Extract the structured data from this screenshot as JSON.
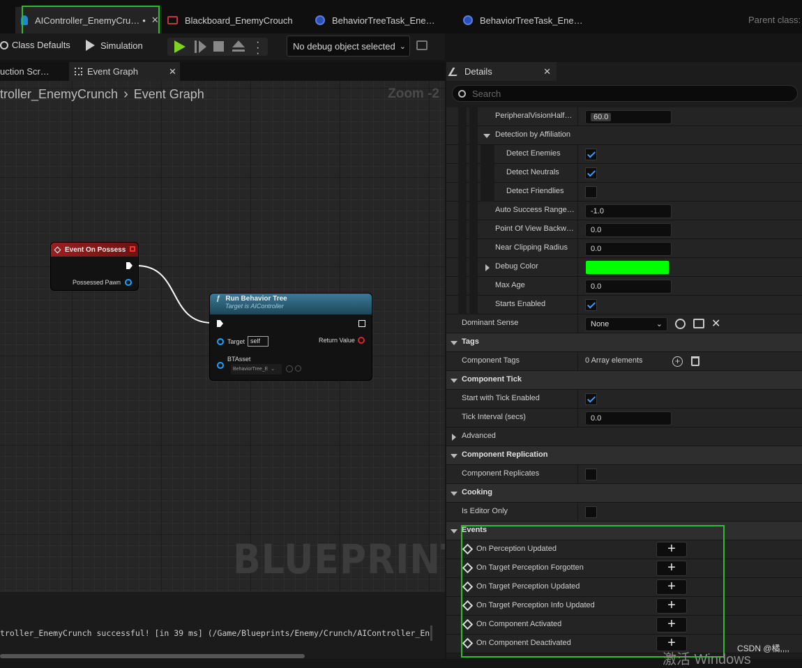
{
  "tabs": {
    "doc1": "AIController_EnemyCru…",
    "doc1_modified": "•",
    "doc2": "Blackboard_EnemyCrouch",
    "doc3": "BehaviorTreeTask_Ene…",
    "doc4": "BehaviorTreeTask_Ene…",
    "parent_class": "Parent class:"
  },
  "toolbar": {
    "class_defaults": "Class Defaults",
    "simulation": "Simulation",
    "debug_object": "No debug object selected"
  },
  "graph_tabs": {
    "construction": "uction Scr…",
    "event_graph": "Event Graph"
  },
  "graph": {
    "breadcrumb_root": "troller_EnemyCrunch",
    "breadcrumb_leaf": "Event Graph",
    "zoom": "Zoom -2",
    "watermark": "BLUEPRINT"
  },
  "nodes": {
    "possess": {
      "title": "Event On Possess",
      "pin_pawn": "Possessed Pawn",
      "color": "#8c1c1c"
    },
    "run_bt": {
      "title": "Run Behavior Tree",
      "subtitle": "Target is AIController",
      "pin_target": "Target",
      "target_value": "self",
      "pin_return": "Return Value",
      "pin_btasset": "BTAsset",
      "btasset_value": "BehaviorTree_E",
      "color": "#2f6a86"
    }
  },
  "log": {
    "line": "troller_EnemyCrunch successful! [in 39 ms] (/Game/Blueprints/Enemy/Crunch/AIController_En"
  },
  "details": {
    "tab": "Details",
    "search_placeholder": "Search",
    "rows": {
      "peripheral": {
        "label": "PeripheralVisionHalf…",
        "value": "60.0"
      },
      "detection_affiliation": "Detection by Affiliation",
      "detect_enemies": "Detect Enemies",
      "detect_neutrals": "Detect Neutrals",
      "detect_friendlies": "Detect Friendlies",
      "auto_success": {
        "label": "Auto Success Range…",
        "value": "-1.0"
      },
      "pov_backward": {
        "label": "Point Of View Backw…",
        "value": "0.0"
      },
      "near_clipping": {
        "label": "Near Clipping Radius",
        "value": "0.0"
      },
      "debug_color": {
        "label": "Debug Color",
        "color": "#00ff00"
      },
      "max_age": {
        "label": "Max Age",
        "value": "0.0"
      },
      "starts_enabled": "Starts Enabled",
      "dominant_sense": {
        "label": "Dominant Sense",
        "value": "None"
      },
      "tags_cat": "Tags",
      "component_tags": {
        "label": "Component Tags",
        "value": "0 Array elements"
      },
      "tick_cat": "Component Tick",
      "start_tick": "Start with Tick Enabled",
      "tick_interval": {
        "label": "Tick Interval (secs)",
        "value": "0.0"
      },
      "advanced": "Advanced",
      "replication_cat": "Component Replication",
      "replicates": "Component Replicates",
      "cooking_cat": "Cooking",
      "editor_only": "Is Editor Only",
      "events_cat": "Events",
      "ev1": "On Perception Updated",
      "ev2": "On Target Perception Forgotten",
      "ev3": "On Target Perception Updated",
      "ev4": "On Target Perception Info Updated",
      "ev5": "On Component Activated",
      "ev6": "On Component Deactivated"
    }
  },
  "overlay": {
    "csdn": "CSDN @橘,,,,",
    "windows": "激活 Windows"
  },
  "colors": {
    "highlight": "#2ebd2e",
    "play": "#7ed321",
    "check": "#3b9cff"
  }
}
